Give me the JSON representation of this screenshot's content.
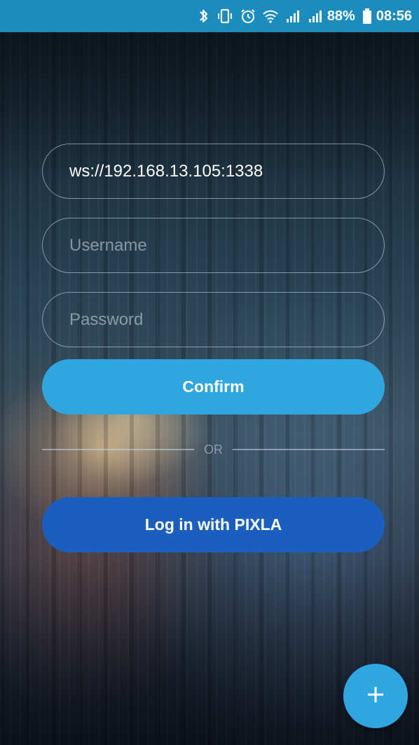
{
  "status_bar": {
    "battery_text": "88%",
    "time": "08:56",
    "icons": [
      "bluetooth-icon",
      "vibrate-icon",
      "alarm-icon",
      "wifi-icon",
      "signal-icon",
      "signal-icon",
      "battery-icon"
    ]
  },
  "form": {
    "server": {
      "value": "ws://192.168.13.105:1338",
      "placeholder": ""
    },
    "username": {
      "value": "",
      "placeholder": "Username"
    },
    "password": {
      "value": "",
      "placeholder": "Password"
    },
    "confirm_label": "Confirm",
    "or_label": "OR",
    "pixla_label": "Log in with PIXLA"
  },
  "fab": {
    "icon": "plus-icon"
  },
  "colors": {
    "status_bar": "#1c8cbf",
    "confirm_button": "#2fa6e0",
    "pixla_button": "#1a5fbf",
    "fab": "#2fa6e0"
  }
}
